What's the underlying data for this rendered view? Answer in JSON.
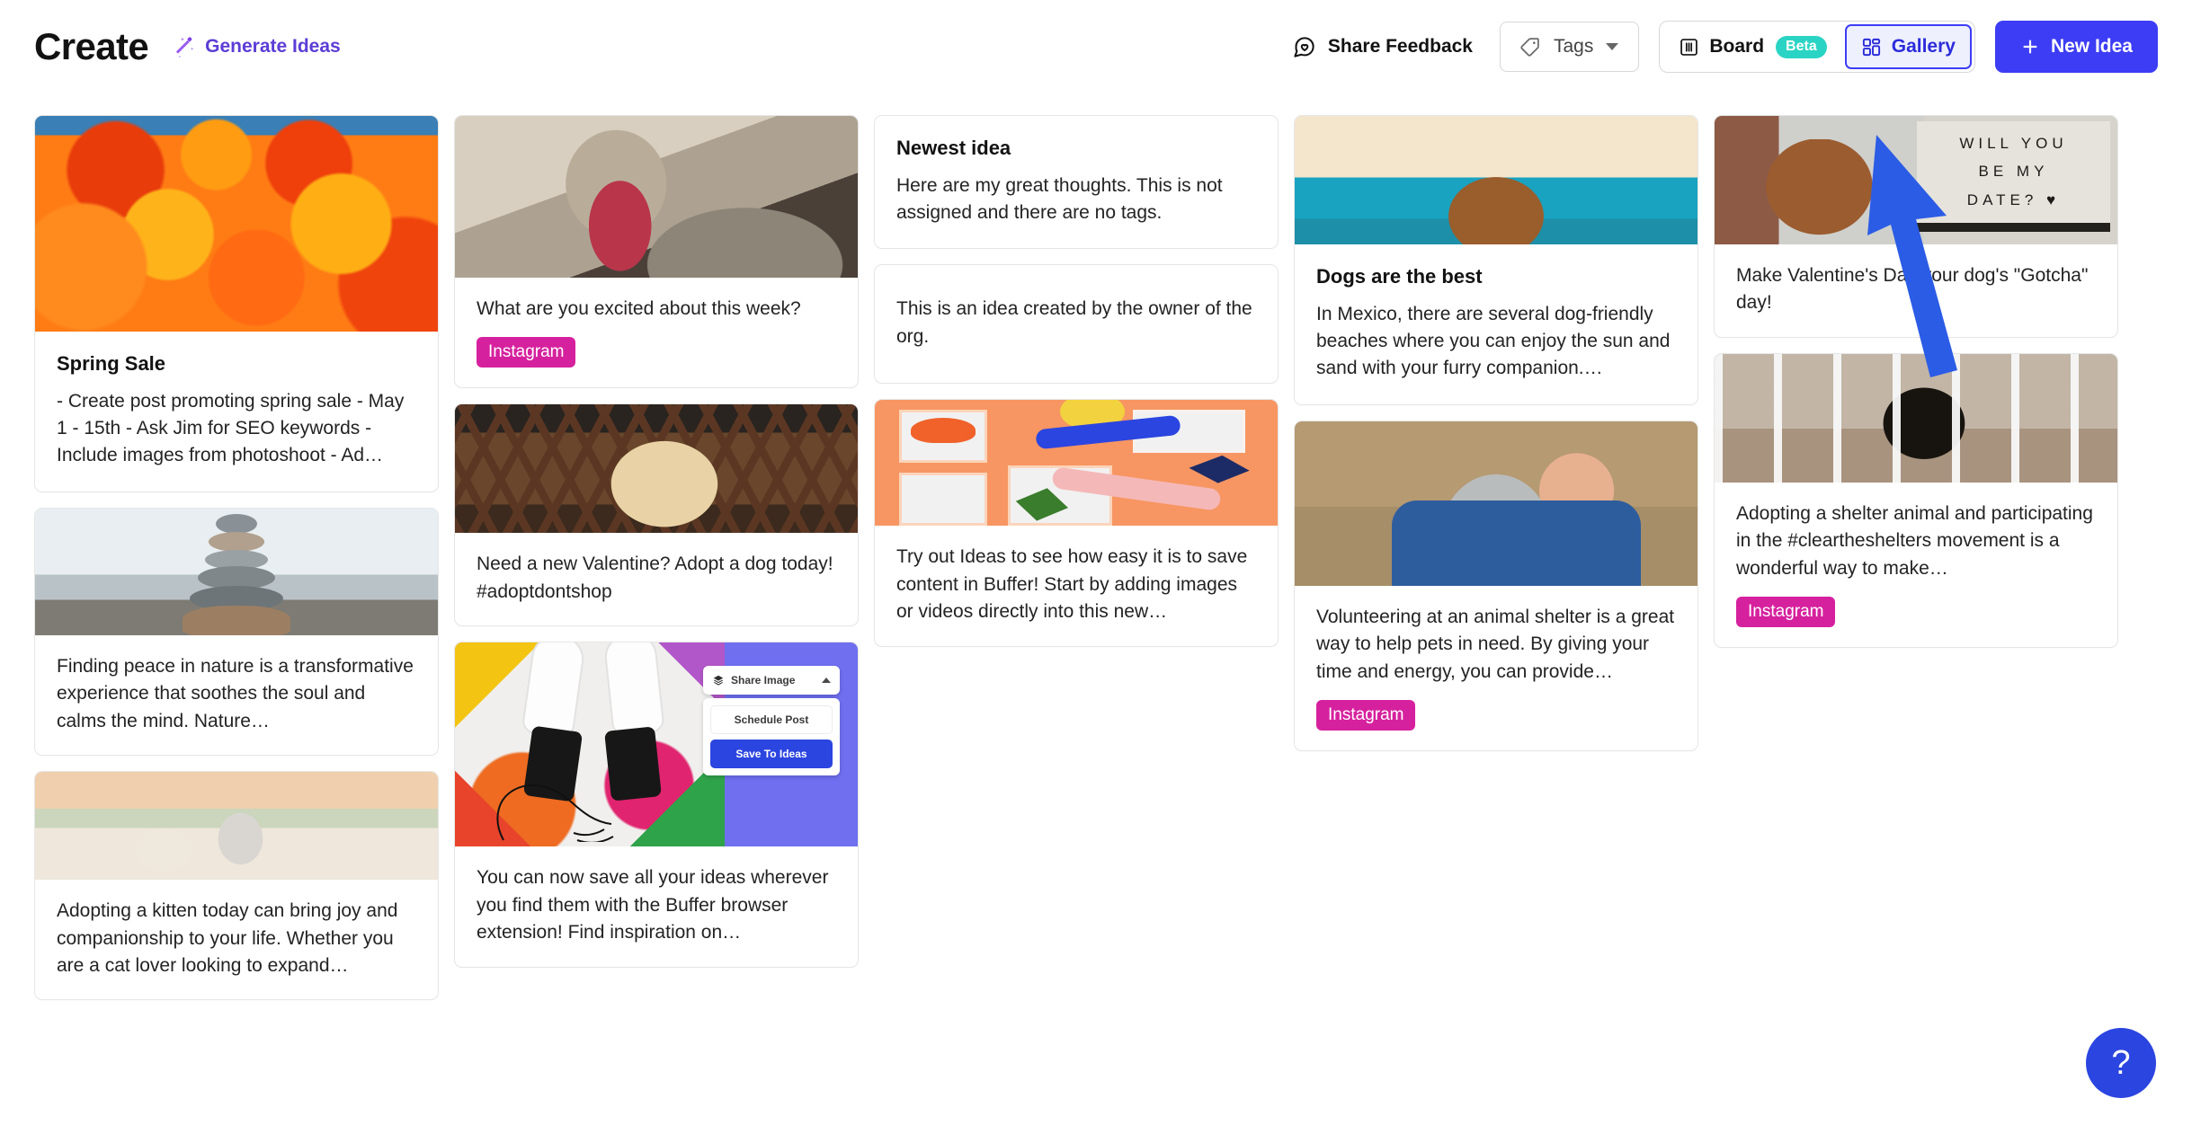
{
  "header": {
    "title": "Create",
    "generate_ideas": "Generate Ideas",
    "share_feedback": "Share Feedback",
    "tags_label": "Tags",
    "board_label": "Board",
    "beta_badge": "Beta",
    "gallery_label": "Gallery",
    "new_idea_label": "New Idea",
    "accent_color": "#3d3df5",
    "generate_color": "#5c3dd6",
    "beta_color": "#2ad4c4"
  },
  "help": {
    "label": "?"
  },
  "tag_colors": {
    "instagram": "#d6219e"
  },
  "columns": [
    {
      "cards": [
        {
          "media": "tulips-photo",
          "title": "Spring Sale",
          "text": "- Create post promoting spring sale - May 1 - 15th - Ask Jim for SEO keywords - Include images from photoshoot - Ad…",
          "tag": null
        },
        {
          "media": "stacked-stones-photo",
          "title": null,
          "text": "Finding peace in nature is a transformative experience that soothes the soul and calms the mind. Nature…",
          "tag": null
        },
        {
          "media": "kitten-on-bed-photo",
          "title": null,
          "text": "Adopting a kitten today can bring joy and companionship to your life. Whether you are a cat lover looking to expand…",
          "tag": null
        }
      ]
    },
    {
      "cards": [
        {
          "media": "yawning-cat-photo",
          "title": null,
          "text": "What are you excited about this week?",
          "tag": "Instagram"
        },
        {
          "media": "dog-with-tulip-photo",
          "title": null,
          "text": "Need a new Valentine? Adopt a dog today! #adoptdontshop",
          "tag": null
        },
        {
          "media": "sneakers-buffer-extension-photo",
          "title": null,
          "text": "You can now save all your ideas wherever you find them with the Buffer browser extension! Find inspiration on…",
          "tag": null,
          "overlay": {
            "head_label": "Share Image",
            "menu": [
              "Schedule Post",
              "Save To Ideas"
            ]
          }
        }
      ]
    },
    {
      "cards": [
        {
          "media": null,
          "title": "Newest idea",
          "text": "Here are my great thoughts. This is not assigned and there are no tags.",
          "tag": null
        },
        {
          "media": null,
          "title": null,
          "text": "This is an idea created by the owner of the org.",
          "tag": null
        },
        {
          "media": "buffer-illustration",
          "title": null,
          "text": "Try out Ideas to see how easy it is to save content in Buffer! Start by adding images or videos directly into this new…",
          "tag": null
        }
      ]
    },
    {
      "cards": [
        {
          "media": "seaside-dog-photo",
          "title": "Dogs are the best",
          "text": "In Mexico, there are several dog-friendly beaches where you can enjoy the sun and sand with your furry companion.…",
          "tag": null
        },
        {
          "media": "man-hugging-dog-photo",
          "title": null,
          "text": "Volunteering at an animal shelter is a great way to help pets in need. By giving your time and energy, you can provide…",
          "tag": "Instagram"
        }
      ]
    },
    {
      "cards": [
        {
          "media": "valentine-dog-sign-photo",
          "title": null,
          "text": "Make Valentine's Day your dog's \"Gotcha\" day!",
          "tag": null,
          "sign_lines": [
            "WILL YOU",
            "BE MY",
            "DATE? ♥"
          ]
        },
        {
          "media": "shelter-cat-photo",
          "title": null,
          "text": "Adopting a shelter animal and participating in the #cleartheshelters movement is a wonderful way to make…",
          "tag": "Instagram"
        }
      ]
    }
  ]
}
